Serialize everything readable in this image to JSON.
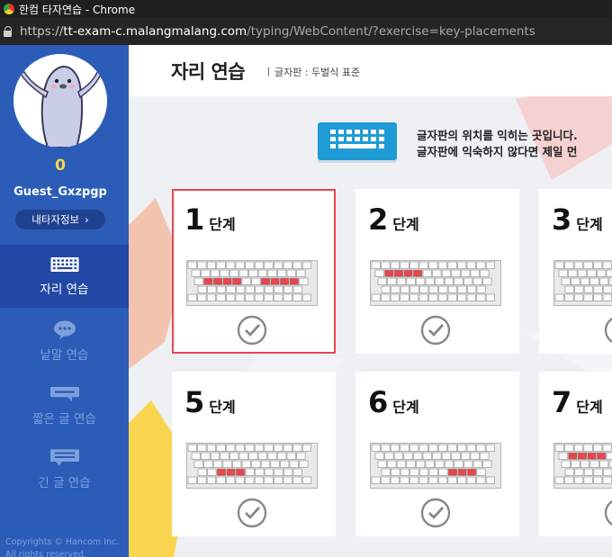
{
  "window": {
    "title": "한컴 타자연습 - Chrome"
  },
  "address_bar": {
    "url_scheme": "https://",
    "url_host": "tt-exam-c.malangmalang.com",
    "url_path": "/typing/WebContent/?exercise=key-placements"
  },
  "sidebar": {
    "score": "0",
    "username": "Guest_Gxzpgp",
    "profile_button": "내타자정보",
    "profile_chevron": "›",
    "menu": [
      {
        "label": "자리 연습",
        "icon": "keyboard-icon",
        "active": true
      },
      {
        "label": "낱말 연습",
        "icon": "speech-bubble-icon",
        "active": false
      },
      {
        "label": "짧은 글 연습",
        "icon": "short-text-icon",
        "active": false
      },
      {
        "label": "긴 글 연습",
        "icon": "long-text-icon",
        "active": false
      }
    ],
    "copyright_line1": "Copyrights © Hancom Inc.",
    "copyright_line2": "All rights reserved."
  },
  "main": {
    "title": "자리 연습",
    "subtitle": "글자판 : 두벌식 표준",
    "intro_line1": "글자판의 위치를 익히는 곳입니다.",
    "intro_line2": "글자판에 익숙하지 않다면 제일 먼"
  },
  "stages": [
    {
      "number": "1",
      "word": "단계",
      "selected": true,
      "completed": true
    },
    {
      "number": "2",
      "word": "단계",
      "selected": false,
      "completed": true
    },
    {
      "number": "3",
      "word": "단계",
      "selected": false,
      "completed": true
    },
    {
      "number": "5",
      "word": "단계",
      "selected": false,
      "completed": true
    },
    {
      "number": "6",
      "word": "단계",
      "selected": false,
      "completed": true
    },
    {
      "number": "7",
      "word": "단계",
      "selected": false,
      "completed": true
    }
  ],
  "colors": {
    "sidebar": "#2b5cb8",
    "sidebar_active": "#2148a4",
    "score": "#ffd54a",
    "selected_border": "#e5474f",
    "highlight_key": "#e5474f",
    "accent_blue": "#1f9bd6"
  }
}
